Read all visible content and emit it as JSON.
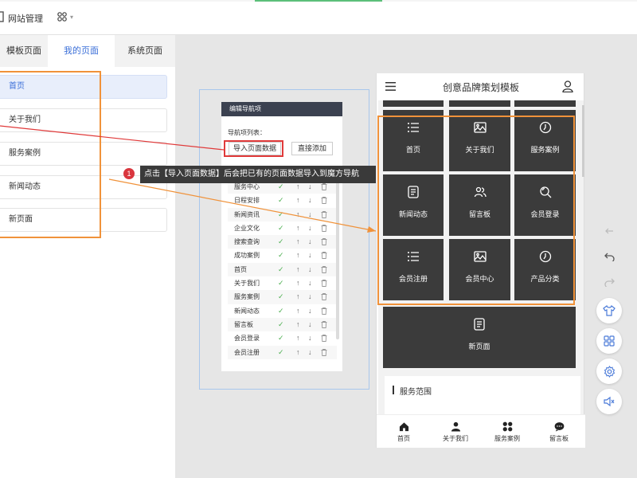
{
  "header": {
    "title": "网站管理"
  },
  "left_panel": {
    "tabs": [
      {
        "label": "模板页面"
      },
      {
        "label": "我的页面"
      },
      {
        "label": "系统页面"
      }
    ],
    "pages": [
      {
        "label": "首页"
      },
      {
        "label": "关于我们"
      },
      {
        "label": "服务案例"
      },
      {
        "label": "新闻动态"
      },
      {
        "label": "新页面"
      }
    ]
  },
  "editor": {
    "title": "编辑导航项",
    "list_label": "导航项列表：",
    "import_button": "导入页面数据",
    "direct_add_button": "直接添加",
    "items": [
      {
        "name": "服务中心",
        "check": "✓",
        "up": "↑",
        "down": "↓"
      },
      {
        "name": "日程安排",
        "check": "✓",
        "up": "↑",
        "down": "↓"
      },
      {
        "name": "新闻资讯",
        "check": "✓",
        "up": "↑",
        "down": "↓"
      },
      {
        "name": "企业文化",
        "check": "✓",
        "up": "↑",
        "down": "↓"
      },
      {
        "name": "搜索查询",
        "check": "✓",
        "up": "↑",
        "down": "↓"
      },
      {
        "name": "成功案例",
        "check": "✓",
        "up": "↑",
        "down": "↓"
      },
      {
        "name": "首页",
        "check": "✓",
        "up": "↑",
        "down": "↓"
      },
      {
        "name": "关于我们",
        "check": "✓",
        "up": "↑",
        "down": "↓"
      },
      {
        "name": "服务案例",
        "check": "✓",
        "up": "↑",
        "down": "↓"
      },
      {
        "name": "新闻动态",
        "check": "✓",
        "up": "↑",
        "down": "↓"
      },
      {
        "name": "留言板",
        "check": "✓",
        "up": "↑",
        "down": "↓"
      },
      {
        "name": "会员登录",
        "check": "✓",
        "up": "↑",
        "down": "↓"
      },
      {
        "name": "会员注册",
        "check": "✓",
        "up": "↑",
        "down": "↓"
      }
    ]
  },
  "callout": {
    "number": "1",
    "text": "点击【导入页面数据】后会把已有的页面数据导入到魔方导航"
  },
  "preview": {
    "title": "创意品牌策划模板",
    "tiles": [
      {
        "label": "首页",
        "icon": "list-icon"
      },
      {
        "label": "关于我们",
        "icon": "image-icon"
      },
      {
        "label": "服务案例",
        "icon": "clock-icon"
      },
      {
        "label": "新闻动态",
        "icon": "document-icon"
      },
      {
        "label": "留言板",
        "icon": "users-icon"
      },
      {
        "label": "会员登录",
        "icon": "search-icon"
      },
      {
        "label": "会员注册",
        "icon": "list-icon"
      },
      {
        "label": "会员中心",
        "icon": "image-icon"
      },
      {
        "label": "产品分类",
        "icon": "clock-icon"
      },
      {
        "label": "新页面",
        "icon": "document-icon"
      }
    ],
    "section_title": "服务范围",
    "footer": [
      {
        "label": "首页",
        "icon": "home-icon"
      },
      {
        "label": "关于我们",
        "icon": "user-icon"
      },
      {
        "label": "服务案例",
        "icon": "grid-icon"
      },
      {
        "label": "留言板",
        "icon": "chat-icon"
      }
    ]
  },
  "colors": {
    "accent_blue": "#3b6fd8",
    "highlight_orange": "#f0923a",
    "highlight_red": "#e03a3a",
    "tile_dark": "#3b3b3b",
    "editor_header": "#3b4150"
  }
}
